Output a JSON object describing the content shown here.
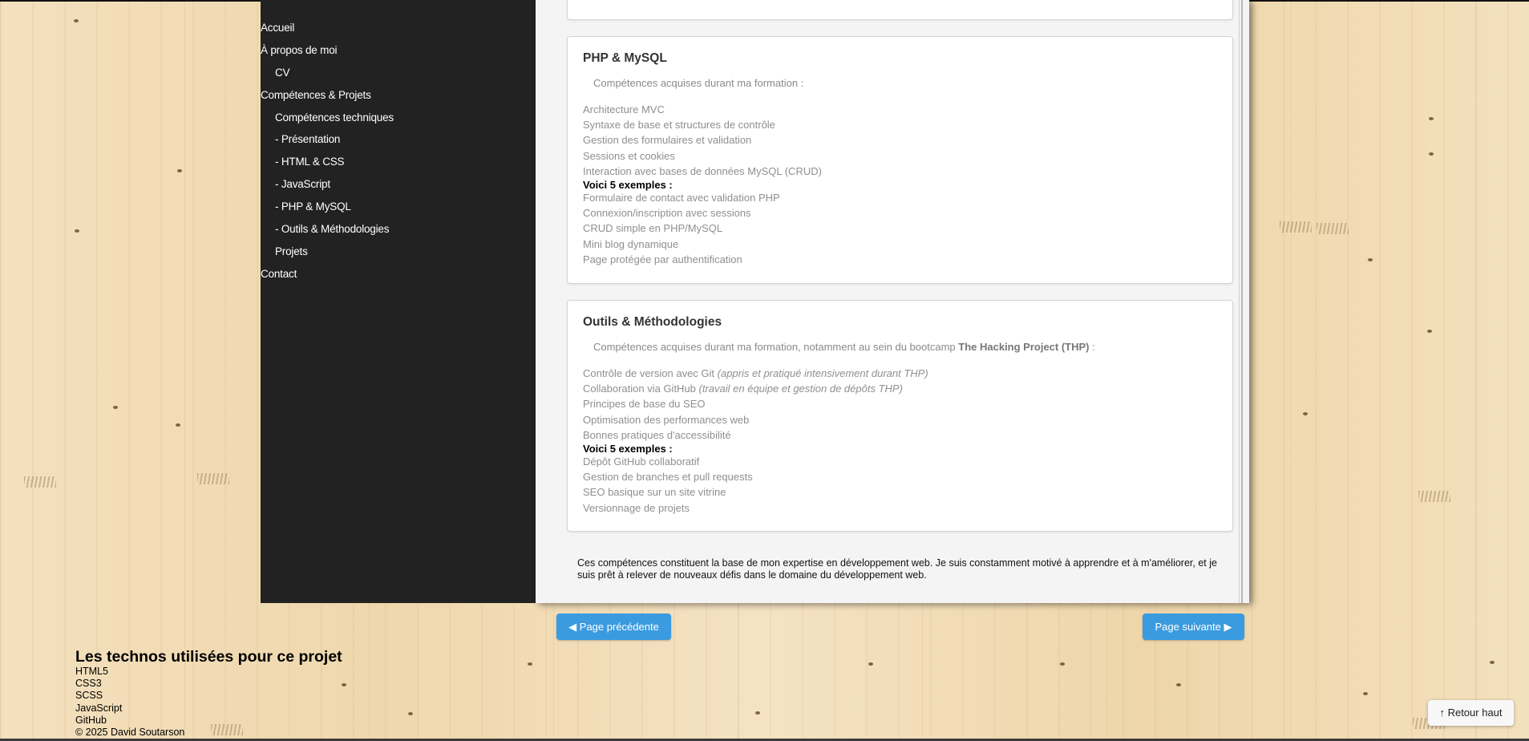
{
  "nav": {
    "items": [
      {
        "label": "Accueil",
        "indent": false
      },
      {
        "label": "À propos de moi",
        "indent": false
      },
      {
        "label": "CV",
        "indent": true
      },
      {
        "label": "Compétences & Projets",
        "indent": false
      },
      {
        "label": "Compétences techniques",
        "indent": true
      },
      {
        "label": "- Présentation",
        "indent": true
      },
      {
        "label": "- HTML & CSS",
        "indent": true
      },
      {
        "label": "- JavaScript",
        "indent": true
      },
      {
        "label": "- PHP & MySQL",
        "indent": true
      },
      {
        "label": "- Outils & Méthodologies",
        "indent": true
      },
      {
        "label": "Projets",
        "indent": true
      },
      {
        "label": "Contact",
        "indent": false
      }
    ]
  },
  "php": {
    "title": "PHP & MySQL",
    "intro": "Compétences acquises durant ma formation :",
    "skills": [
      "Architecture MVC",
      "Syntaxe de base et structures de contrôle",
      "Gestion des formulaires et validation",
      "Sessions et cookies",
      "Interaction avec bases de données MySQL (CRUD)"
    ],
    "examples_title": "Voici 5 exemples :",
    "examples": [
      "Formulaire de contact avec validation PHP",
      "Connexion/inscription avec sessions",
      "CRUD simple en PHP/MySQL",
      "Mini blog dynamique",
      "Page protégée par authentification"
    ]
  },
  "tools": {
    "title": "Outils & Méthodologies",
    "intro_prefix": "Compétences acquises durant ma formation, notamment au sein du bootcamp ",
    "intro_bold": "The Hacking Project (THP)",
    "intro_suffix": " :",
    "skills": [
      {
        "text": "Contrôle de version avec Git ",
        "note": "(appris et pratiqué intensivement durant THP)"
      },
      {
        "text": "Collaboration via GitHub ",
        "note": "(travail en équipe et gestion de dépôts THP)"
      },
      {
        "text": "Principes de base du SEO",
        "note": ""
      },
      {
        "text": "Optimisation des performances web",
        "note": ""
      },
      {
        "text": "Bonnes pratiques d'accessibilité",
        "note": ""
      }
    ],
    "examples_title": "Voici 5 exemples :",
    "examples": [
      "Dépôt GitHub collaboratif",
      "Gestion de branches et pull requests",
      "SEO basique sur un site vitrine",
      "Versionnage de projets"
    ]
  },
  "conclusion": "Ces compétences constituent la base de mon expertise en développement web. Je suis constamment motivé à apprendre et à m'améliorer, et je suis prêt à relever de nouveaux défis dans le domaine du développement web.",
  "pager": {
    "prev": "◀ Page précédente",
    "next": "Page suivante ▶"
  },
  "footer": {
    "title": "Les technos utilisées pour ce projet",
    "techs": [
      "HTML5",
      "CSS3",
      "SCSS",
      "JavaScript",
      "GitHub"
    ],
    "copyright": "© 2025 David Soutarson"
  },
  "back_to_top": "↑ Retour haut",
  "colors": {
    "sidebar_bg": "#222222",
    "button_blue": "#3b9be0",
    "panel_bg": "#f4f4f4"
  }
}
